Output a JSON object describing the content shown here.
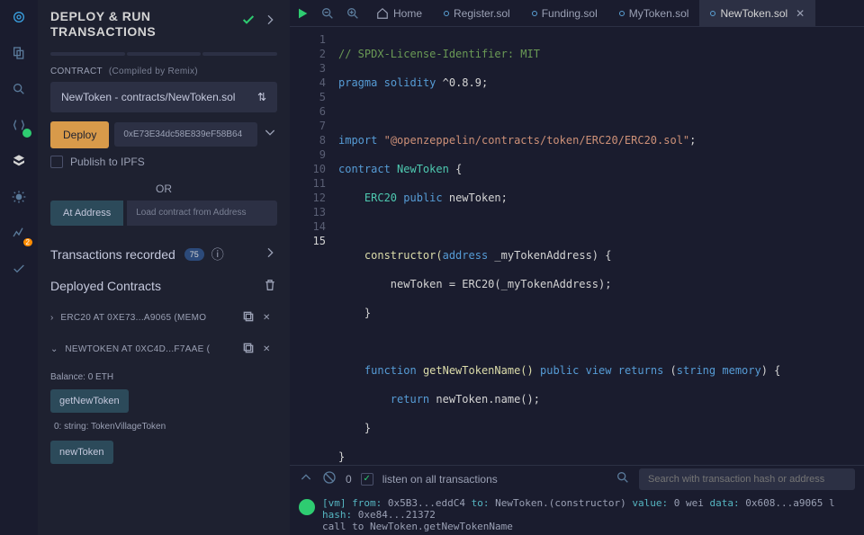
{
  "header": {
    "title": "DEPLOY & RUN\nTRANSACTIONS"
  },
  "contract": {
    "label": "CONTRACT",
    "note": "(Compiled by Remix)",
    "selected": "NewToken - contracts/NewToken.sol"
  },
  "deploy": {
    "label": "Deploy",
    "address": "0xE73E34dc58E839eF58B64",
    "publish_label": "Publish to IPFS",
    "or": "OR",
    "at_address_label": "At Address",
    "at_address_placeholder": "Load contract from Address"
  },
  "transactions": {
    "title": "Transactions recorded",
    "count": "75"
  },
  "deployed": {
    "title": "Deployed Contracts",
    "items": [
      {
        "name": "ERC20 AT 0XE73...A9065 (MEMO"
      },
      {
        "name": "NEWTOKEN AT 0XC4D...F7AAE ("
      }
    ],
    "balance": "Balance: 0 ETH",
    "fn1": "getNewToken",
    "fn1_result": "0: string: TokenVillageToken",
    "fn2": "newToken"
  },
  "tabs": {
    "home": "Home",
    "items": [
      "Register.sol",
      "Funding.sol",
      "MyToken.sol",
      "NewToken.sol"
    ],
    "active": 3
  },
  "code": {
    "lines": 15,
    "p1": "// SPDX-License-Identifier: MIT",
    "p2a": "pragma",
    "p2b": "solidity",
    "p2c": "^0.8.9;",
    "p4a": "import",
    "p4b": "\"@openzeppelin/contracts/token/ERC20/ERC20.sol\"",
    "p4c": ";",
    "p5a": "contract",
    "p5b": "NewToken",
    "p5c": "{",
    "p6a": "ERC20",
    "p6b": "public",
    "p6c": "newToken;",
    "p8a": "constructor(",
    "p8b": "address",
    "p8c": "_myTokenAddress) {",
    "p9": "newToken = ERC20(_myTokenAddress);",
    "p10": "}",
    "p12a": "function",
    "p12b": "getNewTokenName()",
    "p12c": "public",
    "p12d": "view",
    "p12e": "returns",
    "p12f": "(",
    "p12g": "string",
    "p12h": "memory",
    "p12i": ") {",
    "p13a": "return",
    "p13b": "newToken.name();",
    "p14": "}",
    "p15": "}"
  },
  "termbar": {
    "count": "0",
    "listen": "listen on all transactions",
    "search_placeholder": "Search with transaction hash or address"
  },
  "terminal": {
    "l1a": "[vm]",
    "l1b": "from:",
    "l1c": "0x5B3...eddC4",
    "l1d": "to:",
    "l1e": "NewToken.(constructor)",
    "l1f": "value:",
    "l1g": "0 wei",
    "l1h": "data:",
    "l1i": "0x608...a9065 l",
    "l2a": "hash:",
    "l2b": "0xe84...21372",
    "l3": "call to NewToken.getNewTokenName"
  }
}
